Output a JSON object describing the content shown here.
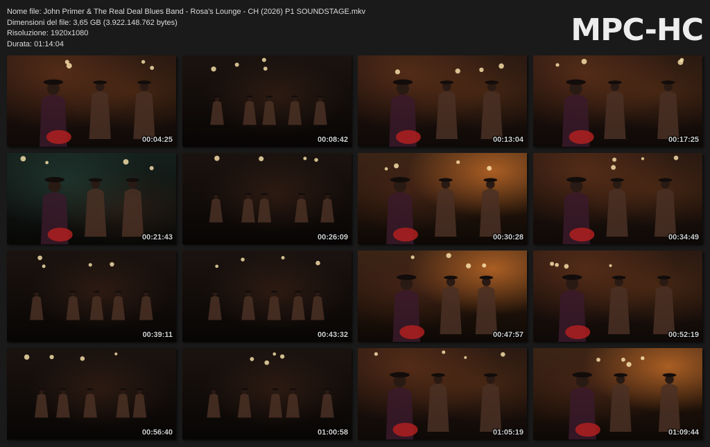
{
  "info": {
    "filename": "Nome file: John Primer & The Real Deal Blues Band - Rosa's Lounge - CH (2026) P1 SOUNDSTAGE.mkv",
    "filesize": "Dimensioni del file: 3,65 GB (3.922.148.762 bytes)",
    "resolution": "Risoluzione: 1920x1080",
    "duration": "Durata: 01:14:04"
  },
  "logo": "MPC-HC",
  "thumbnails": [
    {
      "timestamp": "00:04:25",
      "scene": "warm"
    },
    {
      "timestamp": "00:08:42",
      "scene": "dark"
    },
    {
      "timestamp": "00:13:04",
      "scene": "warm"
    },
    {
      "timestamp": "00:17:25",
      "scene": "warm"
    },
    {
      "timestamp": "00:21:43",
      "scene": "greenish"
    },
    {
      "timestamp": "00:26:09",
      "scene": "dark"
    },
    {
      "timestamp": "00:30:28",
      "scene": "orange"
    },
    {
      "timestamp": "00:34:49",
      "scene": "warm"
    },
    {
      "timestamp": "00:39:11",
      "scene": "dark"
    },
    {
      "timestamp": "00:43:32",
      "scene": "dark"
    },
    {
      "timestamp": "00:47:57",
      "scene": "orange"
    },
    {
      "timestamp": "00:52:19",
      "scene": "warm"
    },
    {
      "timestamp": "00:56:40",
      "scene": "dark"
    },
    {
      "timestamp": "01:00:58",
      "scene": "dark"
    },
    {
      "timestamp": "01:05:19",
      "scene": "warm"
    },
    {
      "timestamp": "01:09:44",
      "scene": "orange"
    }
  ]
}
